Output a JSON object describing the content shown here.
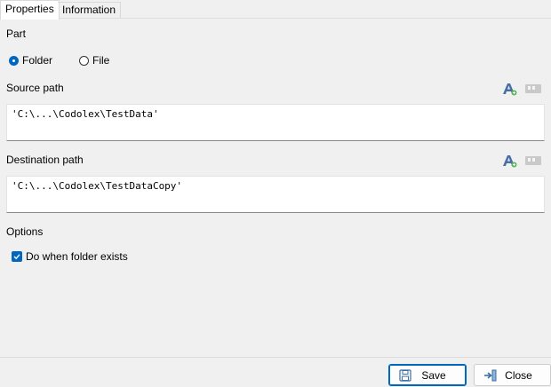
{
  "tabs": [
    {
      "label": "Properties",
      "active": true
    },
    {
      "label": "Information",
      "active": false
    }
  ],
  "part": {
    "label": "Part",
    "options": [
      "Folder",
      "File"
    ],
    "selected": "Folder"
  },
  "source": {
    "label": "Source path",
    "value": "'C:\\...\\Codolex\\TestData'"
  },
  "destination": {
    "label": "Destination path",
    "value": "'C:\\...\\Codolex\\TestDataCopy'"
  },
  "options": {
    "label": "Options",
    "do_when_folder_exists": {
      "label": "Do when folder exists",
      "checked": true
    }
  },
  "buttons": {
    "save": "Save",
    "close": "Close"
  },
  "colors": {
    "accent": "#0067c0",
    "background": "#f0f0f0"
  },
  "icons": {
    "expression": "expression-icon",
    "quote": "quote-icon",
    "save": "floppy-disk-icon",
    "close": "exit-arrow-icon"
  }
}
